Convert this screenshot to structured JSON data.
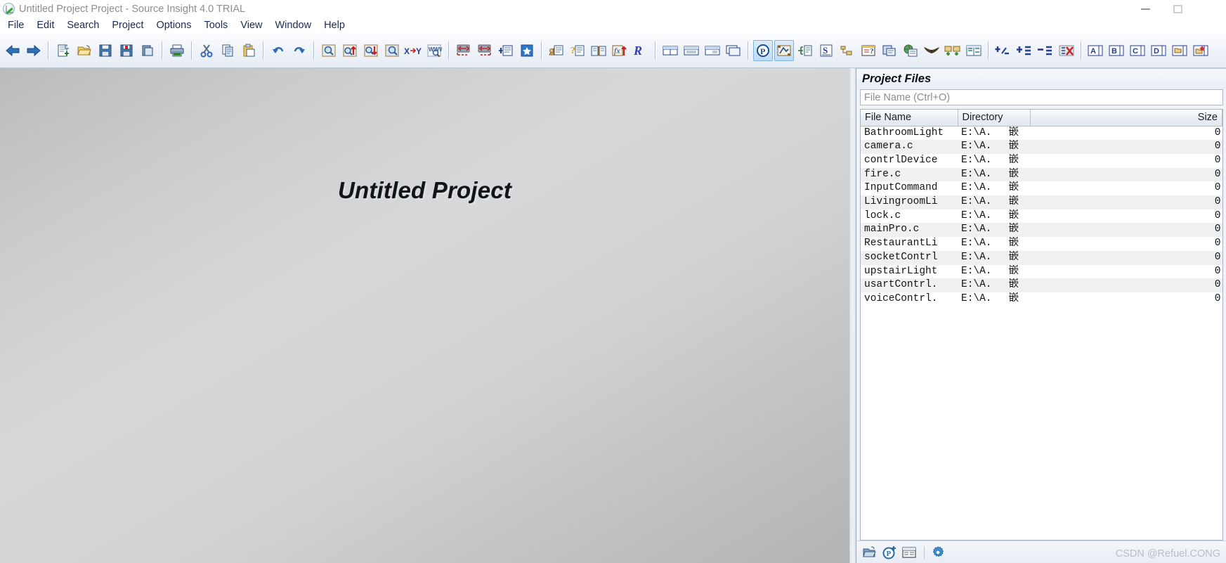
{
  "window": {
    "title": "Untitled Project Project - Source Insight 4.0 TRIAL",
    "app_icon": "source-insight-logo-icon",
    "controls": {
      "minimize": "minimize-icon",
      "restore": "restore-icon",
      "close": "close-icon"
    }
  },
  "menubar": {
    "items": [
      {
        "label": "File"
      },
      {
        "label": "Edit"
      },
      {
        "label": "Search"
      },
      {
        "label": "Project"
      },
      {
        "label": "Options"
      },
      {
        "label": "Tools"
      },
      {
        "label": "View"
      },
      {
        "label": "Window"
      },
      {
        "label": "Help"
      }
    ]
  },
  "toolbar": {
    "groups": [
      {
        "buttons": [
          {
            "icon": "back-arrow-icon",
            "active": false
          },
          {
            "icon": "forward-arrow-icon",
            "active": false
          }
        ]
      },
      {
        "buttons": [
          {
            "icon": "new-file-icon",
            "active": false
          },
          {
            "icon": "open-folder-icon",
            "active": false
          },
          {
            "icon": "save-icon",
            "active": false
          },
          {
            "icon": "save-all-icon",
            "active": false
          },
          {
            "icon": "close-file-icon",
            "active": false
          },
          {
            "icon": "print-icon",
            "active": false
          }
        ]
      },
      {
        "buttons": [
          {
            "icon": "cut-icon",
            "active": false
          },
          {
            "icon": "copy-icon",
            "active": false
          },
          {
            "icon": "paste-icon",
            "active": false
          },
          {
            "icon": "undo-icon",
            "active": false
          },
          {
            "icon": "redo-icon",
            "active": false
          }
        ]
      },
      {
        "buttons": [
          {
            "icon": "search-icon",
            "active": false
          },
          {
            "icon": "search-backward-icon",
            "active": false
          },
          {
            "icon": "search-forward-icon",
            "active": false
          },
          {
            "icon": "search-files-icon",
            "active": false
          },
          {
            "icon": "replace-icon",
            "active": false
          },
          {
            "icon": "web-search-icon",
            "active": false
          }
        ]
      },
      {
        "buttons": [
          {
            "icon": "jump-backward-icon",
            "active": false
          },
          {
            "icon": "jump-forward-icon",
            "active": false
          },
          {
            "icon": "jump-to-definition-icon",
            "active": false
          },
          {
            "icon": "bookmark-icon",
            "active": false
          }
        ]
      },
      {
        "buttons": [
          {
            "icon": "browse-symbols-icon",
            "active": false
          },
          {
            "icon": "context-window-icon",
            "active": false
          },
          {
            "icon": "reference-window-icon",
            "active": false
          },
          {
            "icon": "symbol-lookup-icon",
            "active": false
          },
          {
            "icon": "relation-window-icon",
            "active": false
          }
        ]
      },
      {
        "buttons": [
          {
            "icon": "tile-windows-icon",
            "active": false
          },
          {
            "icon": "horizontal-split-icon",
            "active": false
          },
          {
            "icon": "vertical-split-icon",
            "active": false
          },
          {
            "icon": "cascade-windows-icon",
            "active": false
          }
        ]
      },
      {
        "buttons": [
          {
            "icon": "project-window-icon",
            "active": true
          },
          {
            "icon": "project-symbols-icon",
            "active": true
          },
          {
            "icon": "outline-window-icon",
            "active": false
          },
          {
            "icon": "symbol-window-icon",
            "active": false
          },
          {
            "icon": "context-panel-icon",
            "active": false
          },
          {
            "icon": "annotation-icon",
            "active": false
          },
          {
            "icon": "clip-window-icon",
            "active": false
          },
          {
            "icon": "web-browser-icon",
            "active": false
          },
          {
            "icon": "eagle-icon",
            "active": false
          },
          {
            "icon": "add-files-icon",
            "active": false
          },
          {
            "icon": "file-compare-icon",
            "active": false
          }
        ]
      },
      {
        "buttons": [
          {
            "icon": "add-remove-icon",
            "active": false
          },
          {
            "icon": "expand-outline-icon",
            "active": false
          },
          {
            "icon": "collapse-outline-icon",
            "active": false
          },
          {
            "icon": "clear-outline-icon",
            "active": false
          }
        ]
      },
      {
        "buttons": [
          {
            "icon": "window-a-icon",
            "label": "A",
            "active": false
          },
          {
            "icon": "window-b-icon",
            "label": "B",
            "active": false
          },
          {
            "icon": "window-c-icon",
            "label": "C",
            "active": false
          },
          {
            "icon": "window-d-icon",
            "label": "D",
            "active": false
          },
          {
            "icon": "folder-window-icon",
            "active": false
          },
          {
            "icon": "new-folder-window-icon",
            "active": false
          }
        ]
      }
    ]
  },
  "workspace": {
    "title": "Untitled Project"
  },
  "project_panel": {
    "title": "Project Files",
    "filter": {
      "value": "",
      "placeholder": "File Name (Ctrl+O)"
    },
    "columns": [
      {
        "key": "name",
        "label": "File Name"
      },
      {
        "key": "directory",
        "label": "Directory"
      },
      {
        "key": "size",
        "label": "Size"
      }
    ],
    "rows": [
      {
        "name": "BathroomLight",
        "directory": "E:\\A.",
        "directory_extra": "嵌",
        "size": "0"
      },
      {
        "name": "camera.c",
        "directory": "E:\\A.",
        "directory_extra": "嵌",
        "size": "0"
      },
      {
        "name": "contrlDevice",
        "directory": "E:\\A.",
        "directory_extra": "嵌",
        "size": "0"
      },
      {
        "name": "fire.c",
        "directory": "E:\\A.",
        "directory_extra": "嵌",
        "size": "0"
      },
      {
        "name": "InputCommand",
        "directory": "E:\\A.",
        "directory_extra": "嵌",
        "size": "0"
      },
      {
        "name": "LivingroomLi",
        "directory": "E:\\A.",
        "directory_extra": "嵌",
        "size": "0"
      },
      {
        "name": "lock.c",
        "directory": "E:\\A.",
        "directory_extra": "嵌",
        "size": "0"
      },
      {
        "name": "mainPro.c",
        "directory": "E:\\A.",
        "directory_extra": "嵌",
        "size": "0"
      },
      {
        "name": "RestaurantLi",
        "directory": "E:\\A.",
        "directory_extra": "嵌",
        "size": "0"
      },
      {
        "name": "socketContrl",
        "directory": "E:\\A.",
        "directory_extra": "嵌",
        "size": "0"
      },
      {
        "name": "upstairLight",
        "directory": "E:\\A.",
        "directory_extra": "嵌",
        "size": "0"
      },
      {
        "name": "usartContrl.",
        "directory": "E:\\A.",
        "directory_extra": "嵌",
        "size": "0"
      },
      {
        "name": "voiceContrl.",
        "directory": "E:\\A.",
        "directory_extra": "嵌",
        "size": "0"
      }
    ],
    "bottom_bar": {
      "buttons": [
        {
          "icon": "open-project-file-icon"
        },
        {
          "icon": "add-project-file-icon"
        },
        {
          "icon": "project-report-icon"
        },
        {
          "icon": "settings-gear-icon"
        }
      ]
    }
  },
  "watermark": "CSDN @Refuel.CONG",
  "colors": {
    "accent": "#1b4f9c",
    "title_text": "#8e8e8e",
    "menu_text": "#1b2a52",
    "toolbar_active": "#bedcf6",
    "row_alt": "#f0f0f0"
  }
}
